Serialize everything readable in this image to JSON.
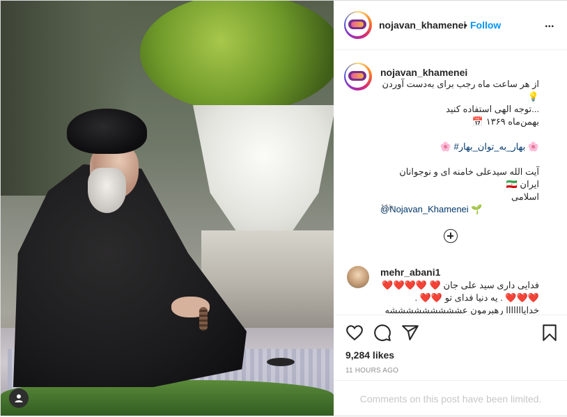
{
  "post": {
    "username": "nojavan_khamenei",
    "separator": "•",
    "follow_label": "Follow",
    "more_label": "•••"
  },
  "caption": {
    "username": "nojavan_khamenei",
    "lines": [
      "از هر ساعت ماه رجب برای به‌دست آوردن 💡",
      "...توجه الهی استفاده کنید",
      "بهمن‌ماه ۱۳۶۹ 📅",
      "",
      "🌸 بهار_به_توان_بهار# 🌸",
      "",
      "آیت الله سیدعلی خامنه ای و نوجوانان ایران 🇮🇷",
      "اسلامی",
      "@Nojavan_Khamenei 🌱"
    ],
    "time": "11h"
  },
  "comment": {
    "username": "mehr_abani1",
    "text": "فدایی داری سید علی جان ❤️ ❤️❤️❤️❤️❤️❤️❤️ . یه دنیا فدای تو ❤️❤️ . خدایااااااا رهبرمون عشششششششششه خودت ❤️❤️❤️ ❤️ بحافظش باش"
  },
  "actions": {
    "likes": "9,284 likes",
    "time_ago": "11 HOURS AGO",
    "limited": "Comments on this post have been limited."
  },
  "colors": {
    "accent": "#0095f6",
    "text": "#262626",
    "muted": "#8e8e8e",
    "heart": "#ed4956"
  },
  "icons": {
    "like": "heart-icon",
    "comment": "comment-icon",
    "share": "share-icon",
    "save": "bookmark-icon",
    "more": "more-icon",
    "load_more": "plus-circle-icon",
    "profile": "user-icon"
  }
}
